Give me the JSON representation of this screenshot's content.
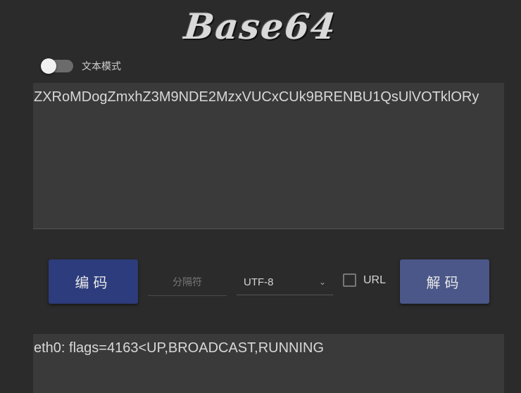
{
  "header": {
    "logo_text": "Base64"
  },
  "mode_toggle": {
    "label": "文本模式",
    "on": false
  },
  "input": {
    "value": "ZXRoMDogZmxhZ3M9NDE2MzxVUCxCUk9BRENBU1QsUlVOTklORy"
  },
  "controls": {
    "encode_label": "编码",
    "separator_placeholder": "分隔符",
    "encoding_selected": "UTF-8",
    "url_label": "URL",
    "url_checked": false,
    "decode_label": "解码"
  },
  "output": {
    "value": "eth0: flags=4163<UP,BROADCAST,RUNNING"
  },
  "colors": {
    "background": "#2b2b2b",
    "panel": "#3a3a3a",
    "encode_button": "#2c3c7c",
    "decode_button": "#4a5788"
  }
}
